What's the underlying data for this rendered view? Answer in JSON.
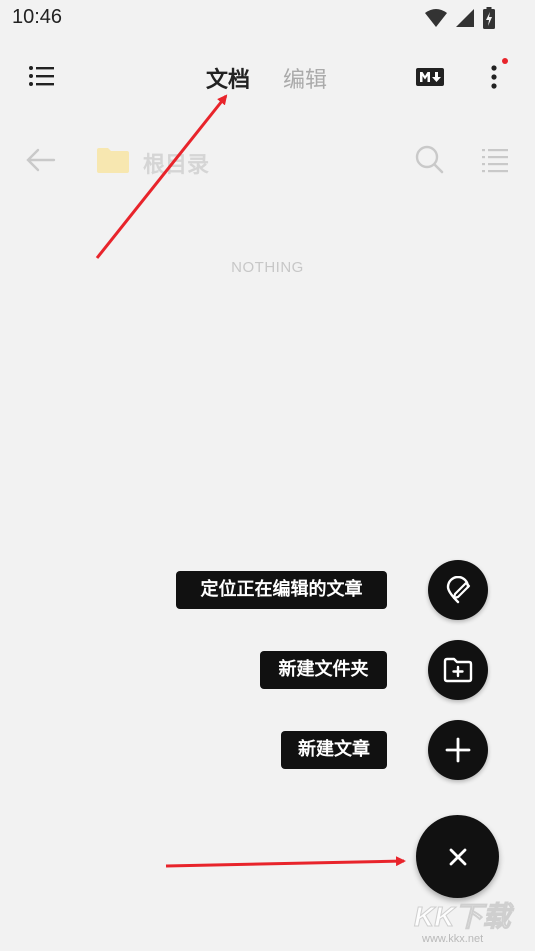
{
  "status_bar": {
    "time": "10:46"
  },
  "app_bar": {
    "tabs": [
      {
        "label": "文档",
        "active": true
      },
      {
        "label": "编辑",
        "active": false
      }
    ],
    "has_notification_dot": true
  },
  "path_bar": {
    "current_folder": "根目录"
  },
  "file_list": {
    "empty_text": "NOTHING"
  },
  "fab_menu": {
    "items": [
      {
        "label": "定位正在编辑的文章",
        "icon": "locate-edit-icon"
      },
      {
        "label": "新建文件夹",
        "icon": "new-folder-icon"
      },
      {
        "label": "新建文章",
        "icon": "plus-icon"
      }
    ],
    "main_icon": "close-icon"
  },
  "watermark": {
    "logo_text": "KK下载",
    "url": "www.kkx.net"
  },
  "colors": {
    "background": "#f2f2f2",
    "fab": "#111111",
    "annotation_arrow": "#e8242b",
    "folder": "#f7e7b0"
  }
}
